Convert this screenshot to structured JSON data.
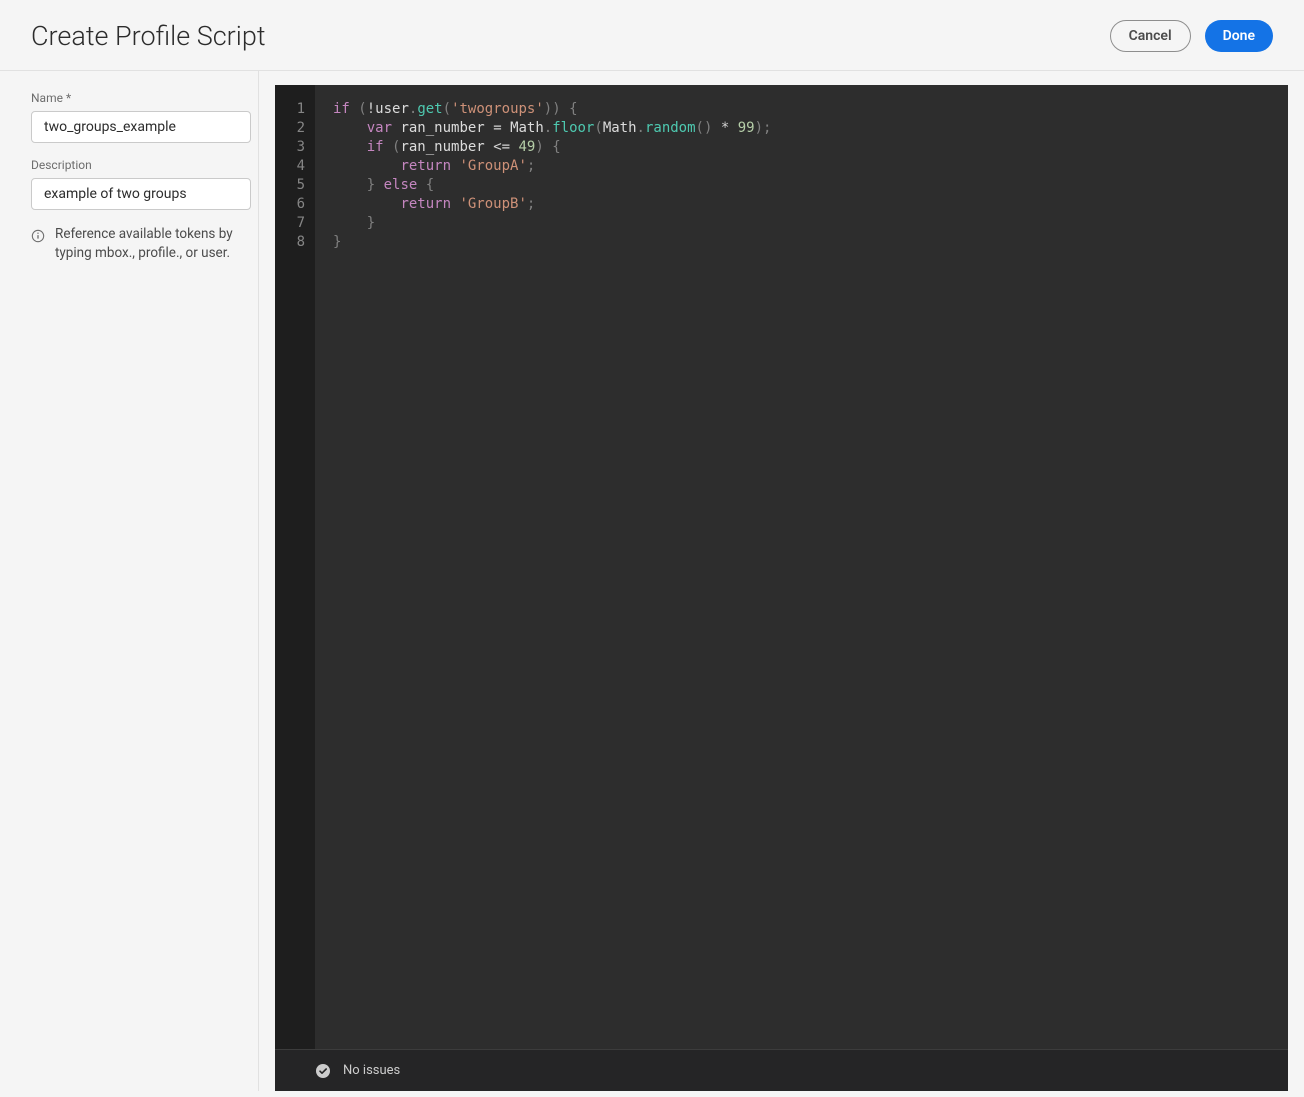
{
  "header": {
    "title": "Create Profile Script",
    "cancel_label": "Cancel",
    "done_label": "Done"
  },
  "sidebar": {
    "name_label": "Name *",
    "name_value": "two_groups_example",
    "description_label": "Description",
    "description_value": "example of two groups",
    "info_text": "Reference available tokens by typing mbox., profile., or user."
  },
  "editor": {
    "line_numbers": [
      "1",
      "2",
      "3",
      "4",
      "5",
      "6",
      "7",
      "8"
    ],
    "code": {
      "l1": {
        "if": "if",
        "not": "!",
        "user": "user",
        "dot1": ".",
        "get": "get",
        "op": "(",
        "str": "'twogroups'",
        "cp": ")",
        "cp2": ")",
        "sp": " ",
        "br": "{"
      },
      "l2": {
        "pad": "    ",
        "var": "var",
        "sp1": " ",
        "ident": "ran_number",
        "sp2": " ",
        "eq": "=",
        "sp3": " ",
        "math1": "Math",
        "dot1": ".",
        "floor": "floor",
        "op": "(",
        "math2": "Math",
        "dot2": ".",
        "random": "random",
        "pp": "()",
        "sp4": " ",
        "star": "*",
        "sp5": " ",
        "num": "99",
        "cp": ")",
        "semi": ";"
      },
      "l3": {
        "pad": "    ",
        "if": "if",
        "sp1": " ",
        "op": "(",
        "ident": "ran_number",
        "sp2": " ",
        "cmp": "<=",
        "sp3": " ",
        "num": "49",
        "cp": ")",
        "sp4": " ",
        "br": "{"
      },
      "l4": {
        "pad": "        ",
        "return": "return",
        "sp": " ",
        "str": "'GroupA'",
        "semi": ";"
      },
      "l5": {
        "pad": "    ",
        "cb": "}",
        "sp": " ",
        "else": "else",
        "sp2": " ",
        "br": "{"
      },
      "l6": {
        "pad": "        ",
        "return": "return",
        "sp": " ",
        "str": "'GroupB'",
        "semi": ";"
      },
      "l7": {
        "pad": "    ",
        "cb": "}"
      },
      "l8": {
        "cb": "}"
      }
    },
    "status_text": "No issues"
  }
}
